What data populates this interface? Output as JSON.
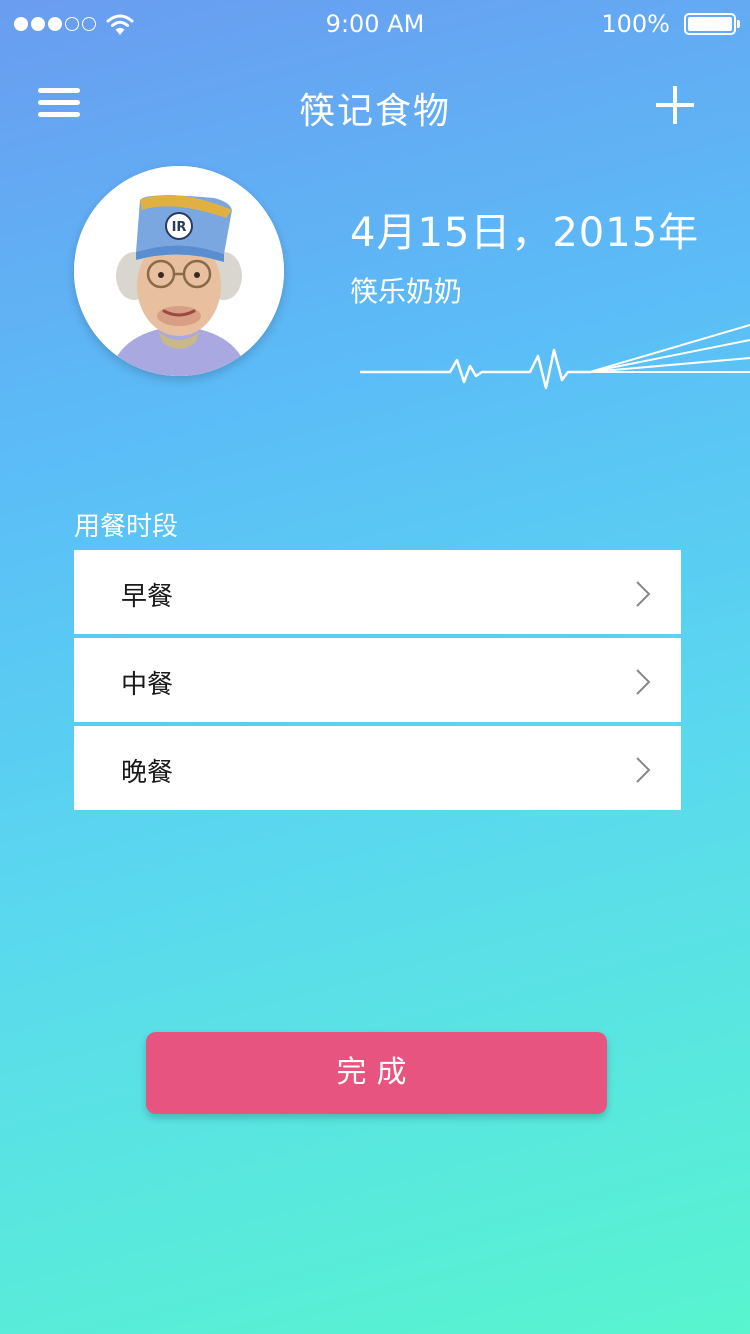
{
  "status_bar": {
    "signal_bars_on": 3,
    "signal_bars_total": 5,
    "time": "9:00 AM",
    "battery_percent_text": "100%",
    "battery_level": 1.0
  },
  "nav": {
    "title": "筷记食物",
    "menu_icon": "hamburger-menu-icon",
    "add_icon": "plus-icon"
  },
  "profile": {
    "date": "4月15日，2015年",
    "name": "筷乐奶奶"
  },
  "meal_section": {
    "label": "用餐时段",
    "items": [
      {
        "label": "早餐"
      },
      {
        "label": "中餐"
      },
      {
        "label": "晚餐"
      }
    ]
  },
  "done_button": {
    "label": "完成"
  },
  "colors": {
    "gradient_top": "#6a9cf0",
    "gradient_bottom": "#58f5cf",
    "button": "#e75480"
  }
}
